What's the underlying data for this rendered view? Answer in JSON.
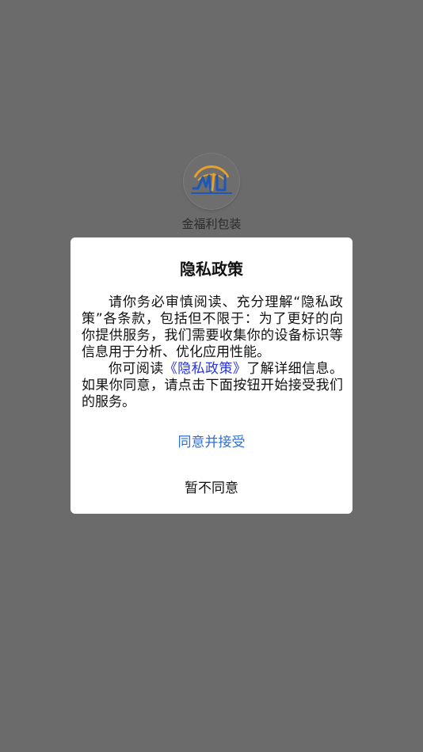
{
  "app": {
    "name": "金福利包装",
    "logo_icon": "jinfuli-logo-icon"
  },
  "colors": {
    "overlay_background": "#6b6b6b",
    "dialog_background": "#ffffff",
    "link_color": "#2a35d6",
    "agree_button_color": "#2f6fd0"
  },
  "dialog": {
    "title": "隐私政策",
    "paragraph1": "请你务必审慎阅读、充分理解“隐私政策”各条款，包括但不限于：为了更好的向你提供服务，我们需要收集你的设备标识等信息用于分析、优化应用性能。",
    "paragraph2_before": "你可阅读",
    "paragraph2_link": "《隐私政策》",
    "paragraph2_after": "了解详细信息。如果你同意，请点击下面按钮开始接受我们的服务。",
    "agree_label": "同意并接受",
    "disagree_label": "暂不同意"
  }
}
